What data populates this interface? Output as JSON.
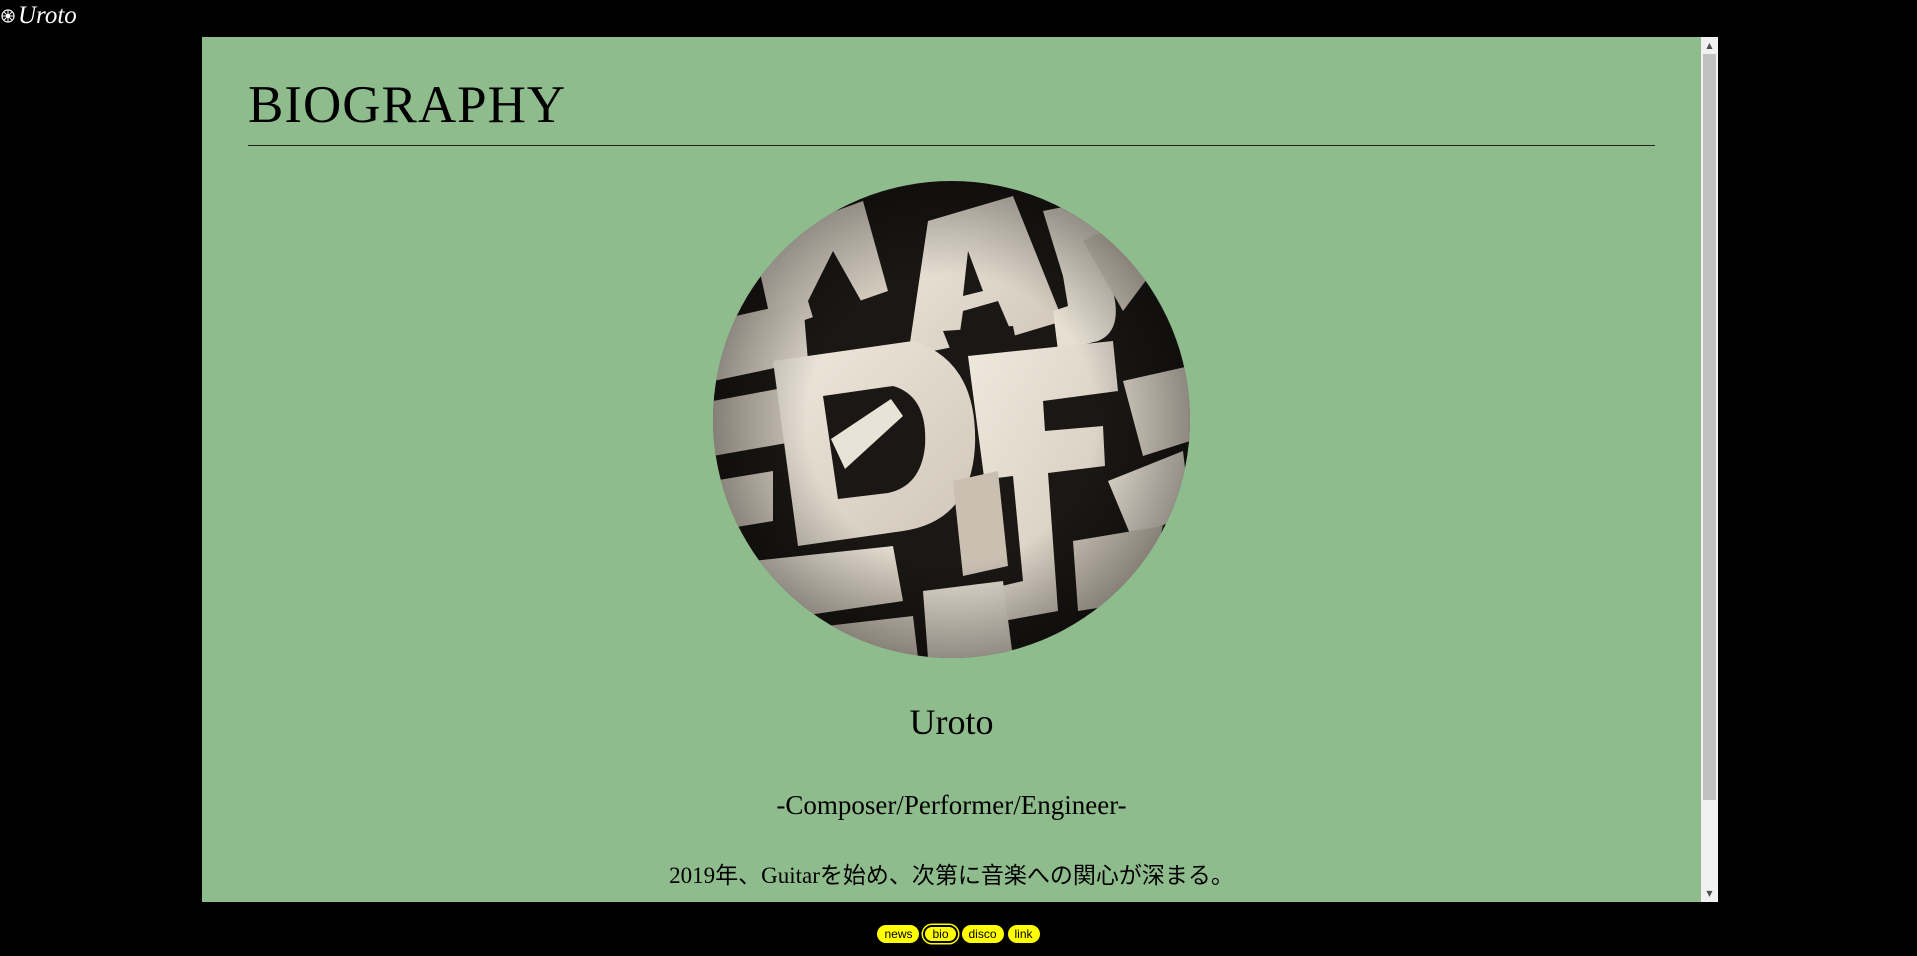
{
  "site": {
    "logo_text": "Uroto"
  },
  "page": {
    "title": "BIOGRAPHY"
  },
  "profile": {
    "name": "Uroto",
    "role": "-Composer/Performer/Engineer-",
    "bio_line": "2019年、Guitarを始め、次第に音楽への関心が深まる。"
  },
  "nav": {
    "items": [
      {
        "label": "news",
        "active": false
      },
      {
        "label": "bio",
        "active": true
      },
      {
        "label": "disco",
        "active": false
      },
      {
        "label": "link",
        "active": false
      }
    ]
  },
  "colors": {
    "background": "#000000",
    "panel": "#8fbc8c",
    "nav_pill": "#ffff00"
  }
}
